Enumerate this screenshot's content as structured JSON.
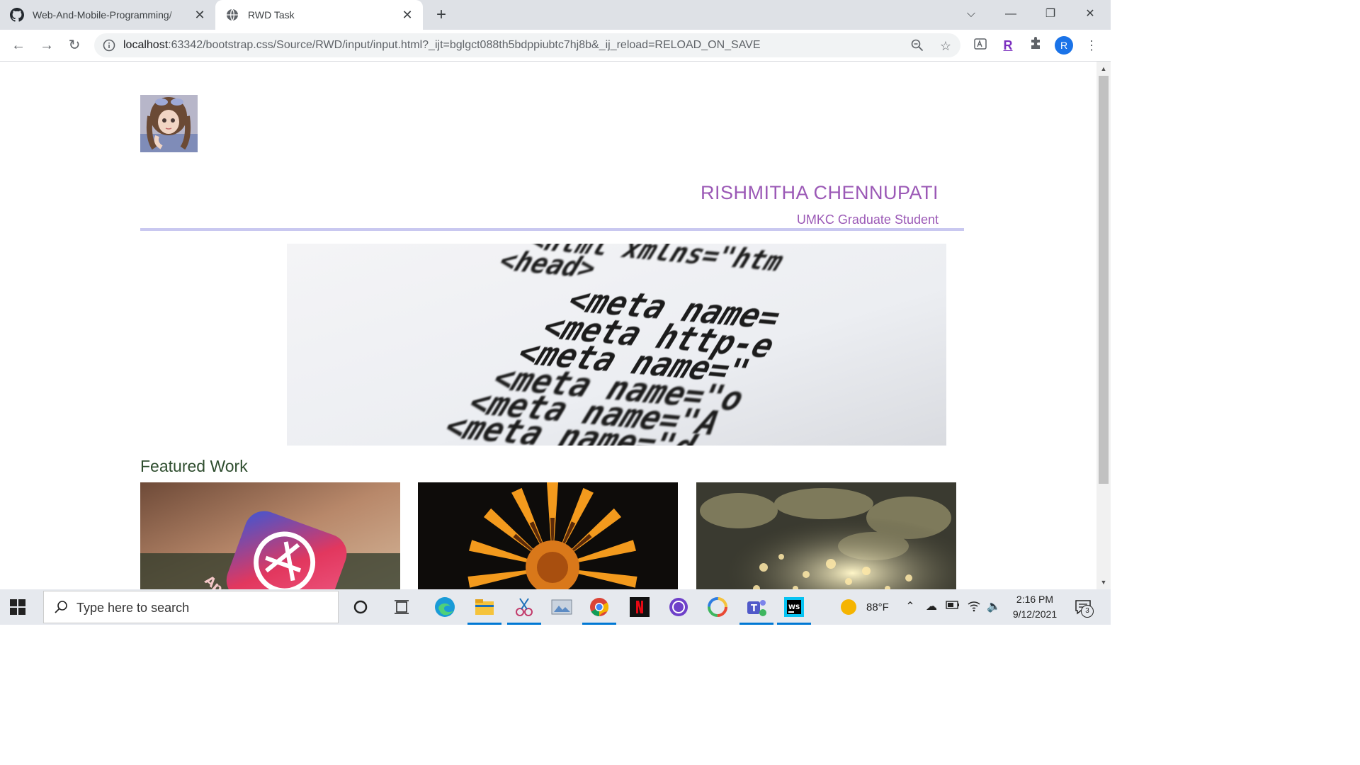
{
  "browser": {
    "tabs": [
      {
        "title": "Web-And-Mobile-Programming/",
        "icon": "github-icon"
      },
      {
        "title": "RWD Task",
        "icon": "globe-icon"
      }
    ],
    "url_host": "localhost",
    "url_rest": ":63342/bootstrap.css/Source/RWD/input/input.html?_ijt=bglgct088th5bdppiubtc7hj8b&_ij_reload=RELOAD_ON_SAVE",
    "profile_initial": "R",
    "extension_letter": "R"
  },
  "page": {
    "name": "RISHMITHA CHENNUPATI",
    "subtitle": "UMKC Graduate Student",
    "featured_heading": "Featured Work",
    "hero_code_lines": [
      "<html  xmlns=\"htm",
      "<head>",
      "<meta   name=",
      "<meta   http-e",
      "<meta   name=\"",
      "<meta   name=\"o",
      "<meta   name=\"A",
      "<meta   name=\"d"
    ],
    "work_items": [
      {
        "label": "App"
      },
      {
        "label": ""
      },
      {
        "label": ""
      }
    ]
  },
  "taskbar": {
    "search_placeholder": "Type here to search",
    "temperature": "88°F",
    "time": "2:16 PM",
    "date": "9/12/2021",
    "notification_count": "3"
  },
  "colors": {
    "accent_purple": "#9b59b6",
    "divider": "#c9c8f0",
    "featured_green": "#2e4d2e"
  }
}
